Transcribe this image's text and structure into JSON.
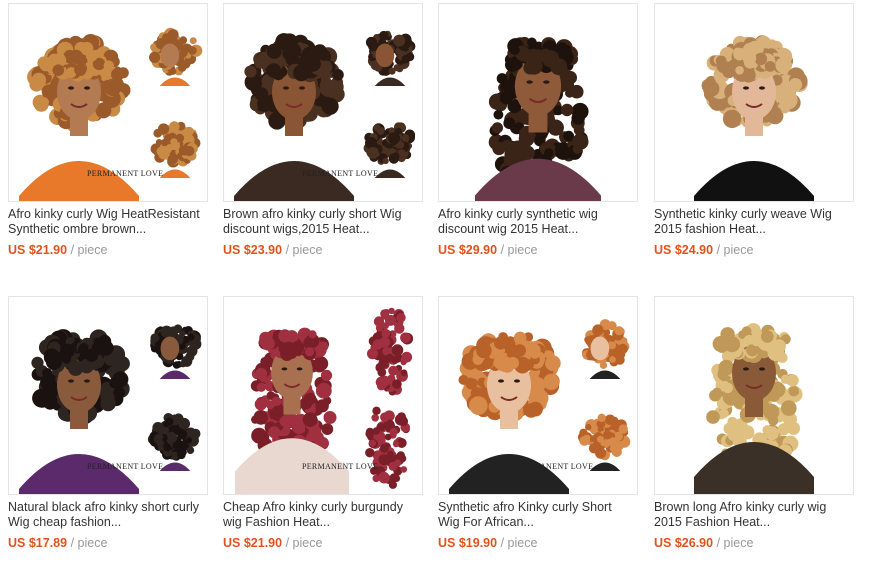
{
  "products": [
    {
      "title_line1": "Afro kinky curly Wig HeatResistant",
      "title_line2": "Synthetic ombre brown...",
      "price": "US $21.90",
      "unit": "/ piece",
      "hair_color": "#9a5a2a",
      "hair_highlight": "#c98a45",
      "skin": "#b47a52",
      "outfit": "#e8782a",
      "watermark": "PERMANENT LOVE"
    },
    {
      "title_line1": "Brown afro kinky curly short Wig",
      "title_line2": "discount wigs,2015 Heat...",
      "price": "US $23.90",
      "unit": "/ piece",
      "hair_color": "#2a1a12",
      "hair_highlight": "#4a3020",
      "skin": "#8a5535",
      "outfit": "#3a2a22",
      "watermark": "PERMANENT LOVE"
    },
    {
      "title_line1": "Afro kinky curly synthetic wig",
      "title_line2": "discount wig 2015 Heat...",
      "price": "US $29.90",
      "unit": "/ piece",
      "hair_color": "#1e120c",
      "hair_highlight": "#3a2418",
      "skin": "#8e5a3a",
      "outfit": "#6a3a4a",
      "watermark": ""
    },
    {
      "title_line1": "Synthetic kinky curly weave Wig",
      "title_line2": "2015 fashion Heat...",
      "price": "US $24.90",
      "unit": "/ piece",
      "hair_color": "#b08050",
      "hair_highlight": "#d8b07a",
      "skin": "#e2b898",
      "outfit": "#111111",
      "watermark": ""
    },
    {
      "title_line1": "Natural black afro kinky short curly",
      "title_line2": "Wig cheap fashion...",
      "price": "US $17.89",
      "unit": "/ piece",
      "hair_color": "#1a1210",
      "hair_highlight": "#2e2420",
      "skin": "#8a5a3c",
      "outfit": "#5a2a6a",
      "watermark": "PERMANENT LOVE"
    },
    {
      "title_line1": "Cheap Afro kinky curly burgundy",
      "title_line2": "wig Fashion Heat...",
      "price": "US $21.90",
      "unit": "/ piece",
      "hair_color": "#7a1e28",
      "hair_highlight": "#a03040",
      "skin": "#a8704e",
      "outfit": "#e8d8d0",
      "watermark": "PERMANENT LOVE"
    },
    {
      "title_line1": "Synthetic afro Kinky curly Short",
      "title_line2": "Wig For African...",
      "price": "US $19.90",
      "unit": "/ piece",
      "hair_color": "#b8622a",
      "hair_highlight": "#d88a4a",
      "skin": "#e8c0a0",
      "outfit": "#222222",
      "watermark": "PERMANENT LOVE"
    },
    {
      "title_line1": "Brown long Afro kinky curly wig",
      "title_line2": "2015 Fashion Heat...",
      "price": "US $26.90",
      "unit": "/ piece",
      "hair_color": "#c09858",
      "hair_highlight": "#e0c080",
      "skin": "#8a5a38",
      "outfit": "#3a3028",
      "watermark": ""
    }
  ]
}
